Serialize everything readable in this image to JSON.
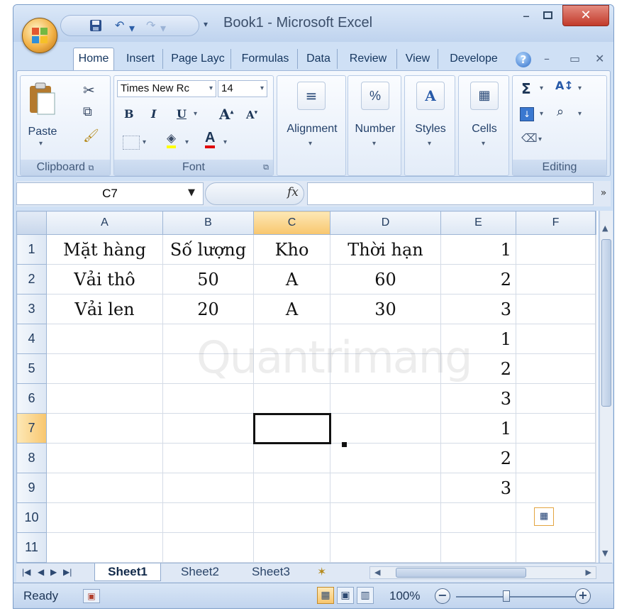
{
  "window": {
    "title": "Book1 - Microsoft Excel",
    "minimize_glyph": "–",
    "close_glyph": "✕"
  },
  "qat": {
    "icons": [
      "save-icon",
      "undo-icon",
      "redo-icon",
      "customize-icon"
    ]
  },
  "ribbon": {
    "tabs": [
      "Home",
      "Insert",
      "Page Layc",
      "Formulas",
      "Data",
      "Review",
      "View",
      "Develope"
    ],
    "active_tab": "Home",
    "groups": {
      "clipboard": {
        "name": "Clipboard",
        "paste_label": "Paste"
      },
      "font": {
        "name": "Font",
        "font_name": "Times New Rc",
        "font_size": "14",
        "bold": "B",
        "italic": "I",
        "underline": "U"
      },
      "alignment": {
        "label": "Alignment"
      },
      "number": {
        "label": "Number",
        "glyph": "%"
      },
      "styles": {
        "label": "Styles"
      },
      "cells": {
        "label": "Cells"
      },
      "editing": {
        "name": "Editing",
        "sum_glyph": "Σ"
      }
    }
  },
  "formula_bar": {
    "name_box": "C7",
    "fx_label": "fx",
    "formula": ""
  },
  "sheet": {
    "columns": [
      "A",
      "B",
      "C",
      "D",
      "E",
      "F"
    ],
    "selected_column": "C",
    "selected_row": "7",
    "rows": [
      {
        "n": "1",
        "cells": [
          "Mặt hàng",
          "Số lượng",
          "Kho",
          "Thời hạn",
          "1",
          ""
        ]
      },
      {
        "n": "2",
        "cells": [
          "Vải thô",
          "50",
          "A",
          "60",
          "2",
          ""
        ]
      },
      {
        "n": "3",
        "cells": [
          "Vải len",
          "20",
          "A",
          "30",
          "3",
          ""
        ]
      },
      {
        "n": "4",
        "cells": [
          "",
          "",
          "",
          "",
          "1",
          ""
        ]
      },
      {
        "n": "5",
        "cells": [
          "",
          "",
          "",
          "",
          "2",
          ""
        ]
      },
      {
        "n": "6",
        "cells": [
          "",
          "",
          "",
          "",
          "3",
          ""
        ]
      },
      {
        "n": "7",
        "cells": [
          "",
          "",
          "",
          "",
          "1",
          ""
        ]
      },
      {
        "n": "8",
        "cells": [
          "",
          "",
          "",
          "",
          "2",
          ""
        ]
      },
      {
        "n": "9",
        "cells": [
          "",
          "",
          "",
          "",
          "3",
          ""
        ]
      },
      {
        "n": "10",
        "cells": [
          "",
          "",
          "",
          "",
          "",
          ""
        ]
      },
      {
        "n": "11",
        "cells": [
          "",
          "",
          "",
          "",
          "",
          ""
        ]
      }
    ],
    "watermark": "Quantrimang"
  },
  "sheet_tabs": {
    "tabs": [
      "Sheet1",
      "Sheet2",
      "Sheet3"
    ],
    "active": "Sheet1"
  },
  "status": {
    "ready": "Ready",
    "zoom": "100%"
  },
  "colors": {
    "selection_header": "#f8c66e",
    "ribbon_bg": "#dbe7f6",
    "close_button": "#c23a2a"
  }
}
